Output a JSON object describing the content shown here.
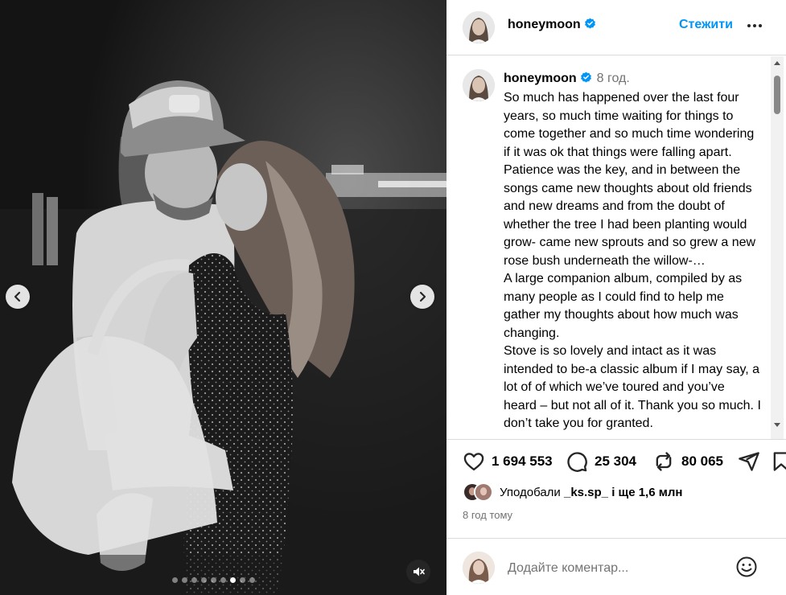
{
  "post": {
    "username": "honeymoon",
    "follow_label": "Стежити",
    "more_icon": "more-horizontal-icon",
    "verified_icon": "verified-badge-icon"
  },
  "caption": {
    "username": "honeymoon",
    "time": "8 год.",
    "text": "So much has happened over the last four years, so much time waiting for things to come together and so much time wondering if it was ok that things were falling apart. Patience was the key, and in between the songs came new thoughts about old friends and new dreams and from the doubt of whether the tree I had been planting would grow- came new sprouts and so grew a new rose bush underneath the willow-…\nA large companion album, compiled by as many people as I could find to help me gather my thoughts about how much was changing.\nStove is so lovely and intact as it was intended to be-a classic album if I may say, a lot of of which we’ve toured and you’ve heard – but not all of it. Thank you so much. I don’t take you for granted."
  },
  "actions": {
    "likes_count": "1 694 553",
    "comments_count": "25 304",
    "reposts_count": "80 065",
    "icons": [
      "heart-icon",
      "comment-icon",
      "repost-icon",
      "share-icon",
      "bookmark-icon"
    ]
  },
  "liked_by": {
    "prefix": "Уподобали ",
    "user": "_ks.sp_",
    "suffix": " і ще 1,6 млн"
  },
  "posted_ago": "8 год тому",
  "comment": {
    "placeholder": "Додайте коментар..."
  },
  "carousel": {
    "slide_count": 9,
    "active_index": 6
  },
  "colors": {
    "accent": "#0095f6",
    "secondary_text": "#737373",
    "border": "#dbdbdb"
  }
}
